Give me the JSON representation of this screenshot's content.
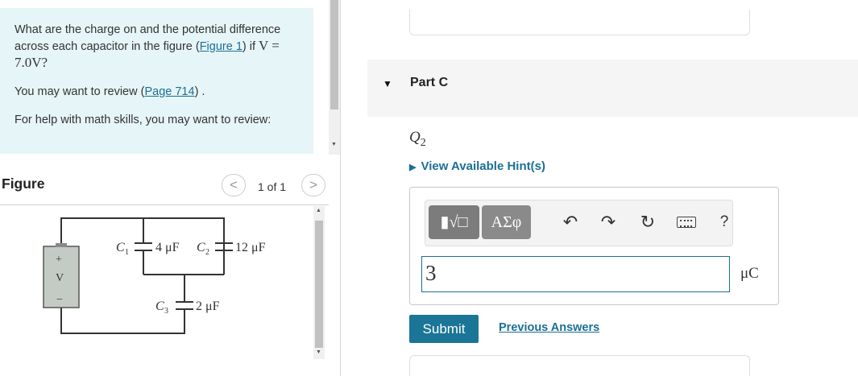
{
  "problem": {
    "question_prefix": "What are the charge on and the potential difference across each capacitor in the figure (",
    "figure_link": "Figure 1",
    "question_mid": ") if ",
    "question_math": "V = 7.0V?",
    "review_prefix": "You may want to review (",
    "review_link": "Page 714",
    "review_suffix": ") .",
    "math_help": "For help with math skills, you may want to review:"
  },
  "figure": {
    "title": "Figure",
    "pager": "1 of 1",
    "prev_glyph": "<",
    "next_glyph": ">",
    "battery_plus": "+",
    "battery_label": "V",
    "battery_minus": "−",
    "c1_name": "C",
    "c1_sub": "1",
    "c1_value": "4 μF",
    "c2_name": "C",
    "c2_sub": "2",
    "c2_value": "12 μF",
    "c3_name": "C",
    "c3_sub": "3",
    "c3_value": "2 μF"
  },
  "part": {
    "label": "Part C",
    "quantity": "Q",
    "quantity_sub": "2",
    "hint": "View Available Hint(s)"
  },
  "toolbar": {
    "templates_label": "▮√□",
    "greek_label": "ΑΣφ",
    "undo": "↶",
    "redo": "↷",
    "reset": "↻",
    "help": "?"
  },
  "answer": {
    "value": "3",
    "unit": "μC"
  },
  "actions": {
    "submit": "Submit",
    "previous_answers": "Previous Answers"
  }
}
